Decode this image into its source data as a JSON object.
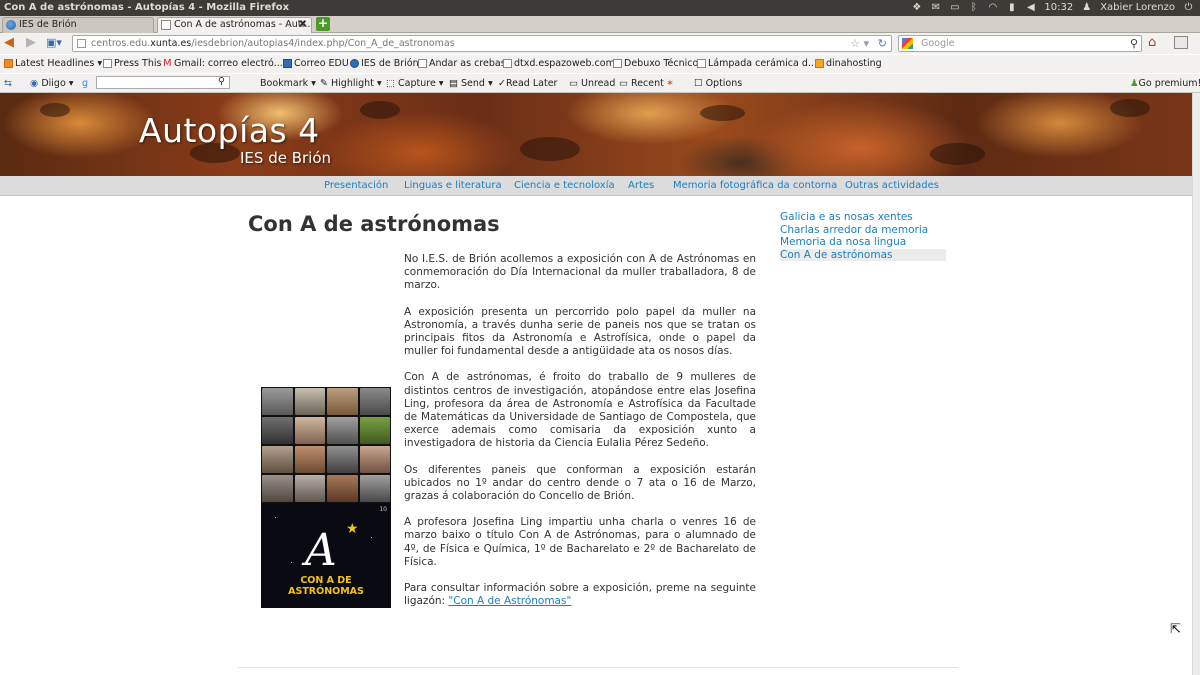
{
  "os": {
    "window_title": "Con A de astrónomas - Autopías 4 - Mozilla Firefox",
    "time": "10:32",
    "user": "Xabier Lorenzo"
  },
  "tabs": [
    {
      "label": "IES de Brión",
      "active": false
    },
    {
      "label": "Con A de astrónomas - Aut...",
      "active": true
    }
  ],
  "nav": {
    "url_prefix": "centros.edu.",
    "url_host": "xunta.es",
    "url_path": "/iesdebrion/autopias4/index.php/Con_A_de_astronomas",
    "search_placeholder": "Google"
  },
  "bookmarks": [
    {
      "label": "Latest Headlines ▾",
      "icon": "rss-icon"
    },
    {
      "label": "Press This",
      "icon": "page-icon"
    },
    {
      "label": "Gmail: correo electró...",
      "icon": "gmail-icon"
    },
    {
      "label": "Correo EDU",
      "icon": "mail-icon"
    },
    {
      "label": "IES de Brión",
      "icon": "globe-icon"
    },
    {
      "label": "Andar as crebas",
      "icon": "page-icon"
    },
    {
      "label": "dtxd.espazoweb.com",
      "icon": "page-icon"
    },
    {
      "label": "Debuxo Técnico",
      "icon": "page-icon"
    },
    {
      "label": "Lámpada cerámica d...",
      "icon": "page-icon"
    },
    {
      "label": "dinahosting",
      "icon": "dinahosting-icon"
    }
  ],
  "diigo": {
    "brand": "Diigo ▾",
    "bookmark": "Bookmark ▾",
    "highlight": "Highlight ▾",
    "capture": "Capture ▾",
    "send": "Send ▾",
    "read_later": "Read Later",
    "unread": "Unread",
    "recent": "Recent",
    "options": "Options",
    "premium": "Go premium!"
  },
  "site": {
    "title": "Autopías 4",
    "subtitle": "IES de Brión"
  },
  "topnav": [
    "Presentación",
    "Linguas e literatura",
    "Ciencia e tecnoloxía",
    "Artes",
    "Memoria fotográfica da contorna",
    "Outras actividades"
  ],
  "page_title": "Con A de astrónomas",
  "sidebar": [
    {
      "label": "Galicia e as nosas xentes",
      "current": false
    },
    {
      "label": "Charlas arredor da memoria",
      "current": false
    },
    {
      "label": "Memoria da nosa lingua",
      "current": false
    },
    {
      "label": "Con A de astrónomas",
      "current": true
    }
  ],
  "article": {
    "p1": "No I.E.S. de Brión acollemos a exposición con A de Astrónomas en conmemoración do Día Internacional da muller traballadora, 8 de marzo.",
    "p2": "A exposición presenta un percorrido polo papel da muller na Astronomía, a través dunha serie de paneis nos que se tratan os principais fitos da Astronomía e Astrofísica, onde o papel da muller foi fundamental desde a antigüidade ata os nosos días.",
    "p3": "Con A de astrónomas, é froito do traballo de 9 mulleres de distintos centros de investigación, atopándose entre elas Josefina Ling, profesora da área de Astronomía e Astrofísica da Facultade de Matemáticas da Universidade de Santiago de Compostela, que exerce ademais como comisaria da exposición xunto a investigadora de historia da Ciencia Eulalia Pérez Sedeño.",
    "p4": "Os diferentes paneis que conforman a exposición estarán ubicados no 1º andar do centro dende o 7 ata o 16 de Marzo, grazas á colaboración do Concello de Brión.",
    "p5": "A profesora Josefina Ling impartiu unha charla o venres 16 de marzo baixo o título Con A de Astrónomas, para o alumnado de 4º, de Física e Química, 1º de Bacharelato e 2º de Bacharelato de Física.",
    "p6": "Para consultar información sobre a exposición, preme na seguinte ligazón:",
    "link": "\"Con A de Astrónomas\""
  },
  "poster": {
    "letter": "A",
    "line1": "CON A DE",
    "line2": "ASTRÓNOMAS",
    "mini": "10"
  }
}
